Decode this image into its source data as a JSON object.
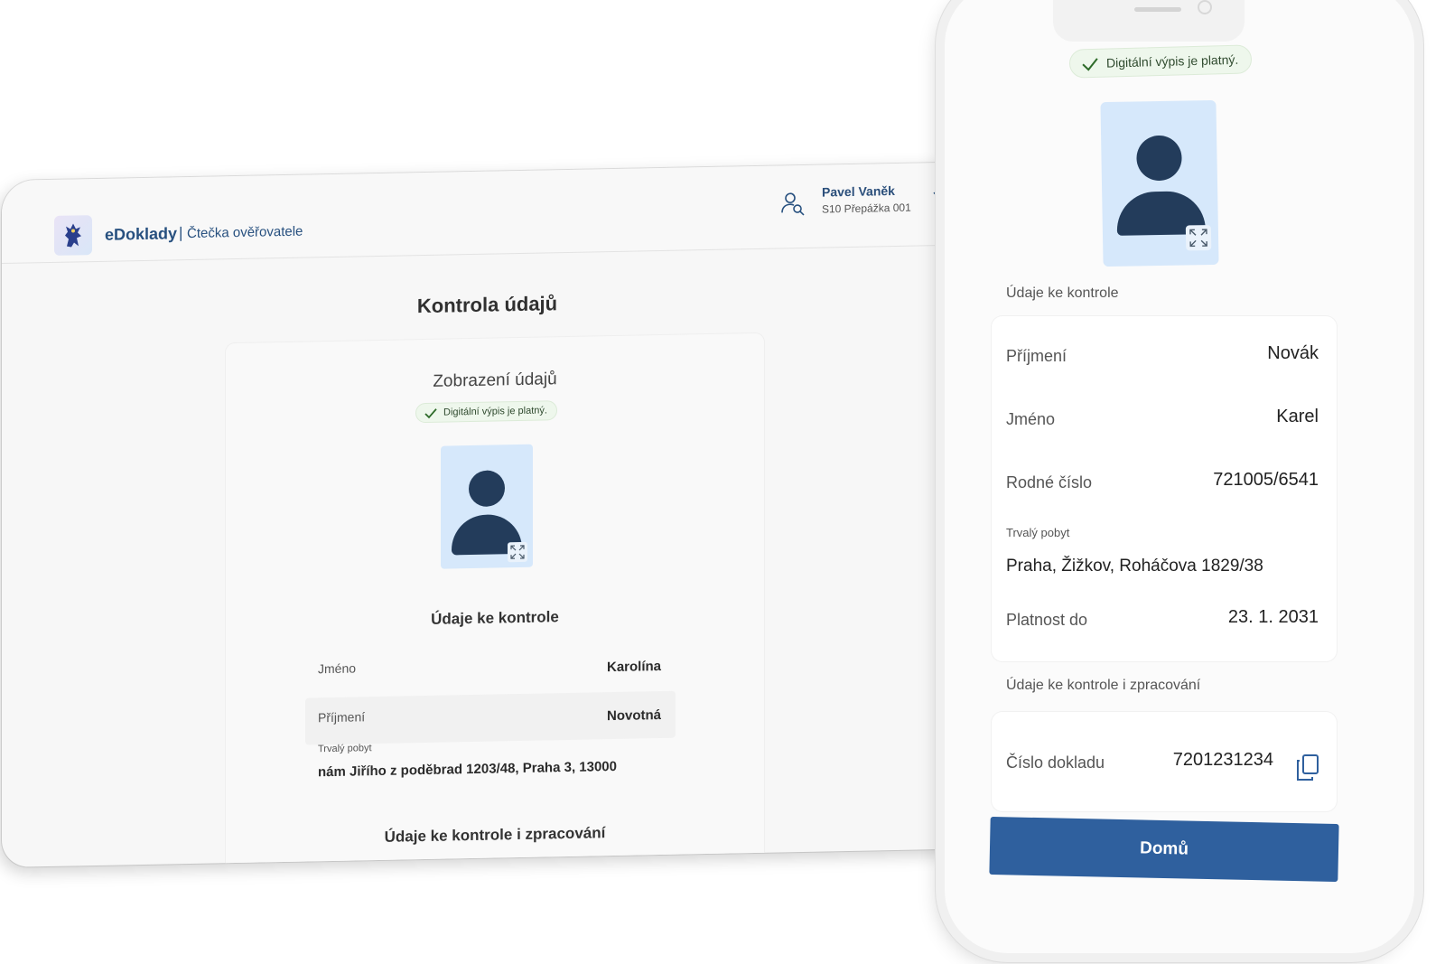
{
  "tablet": {
    "brand": "eDoklady",
    "separator": "|",
    "subtitle": "Čtečka ověřovatele",
    "user": {
      "name": "Pavel Vaněk",
      "desk": "S10 Přepážka 001"
    },
    "page_title": "Kontrola údajů",
    "card": {
      "title": "Zobrazení údajů",
      "badge": "Digitální výpis je platný.",
      "section_title": "Údaje ke kontrole",
      "rows": [
        {
          "label": "Jméno",
          "value": "Karolína"
        },
        {
          "label": "Příjmení",
          "value": "Novotná"
        }
      ],
      "address_label": "Trvalý pobyt",
      "address_value": "nám Jiřího z poděbrad 1203/48, Praha 3, 13000",
      "section2_title": "Údaje ke kontrole i zpracování"
    }
  },
  "phone": {
    "badge": "Digitální výpis je platný.",
    "section_title": "Údaje ke kontrole",
    "rows": [
      {
        "label": "Příjmení",
        "value": "Novák"
      },
      {
        "label": "Jméno",
        "value": "Karel"
      },
      {
        "label": "Rodné číslo",
        "value": "721005/6541"
      }
    ],
    "address_label": "Trvalý pobyt",
    "address_value": "Praha, Žižkov, Roháčova 1829/38",
    "validity_label": "Platnost do",
    "validity_value": "23. 1. 2031",
    "section2_title": "Údaje ke kontrole i zpracování",
    "doc_label": "Číslo dokladu",
    "doc_value": "7201231234",
    "home_button": "Domů"
  },
  "colors": {
    "brand_blue": "#27507f",
    "button_blue": "#2f609e",
    "photo_bg": "#d6e8fb",
    "silhouette": "#233c5b",
    "badge_bg": "#eef7ec",
    "check_green": "#2e6b2a"
  },
  "icons": [
    "lion-emblem-icon",
    "user-search-icon",
    "chevron-down-icon",
    "check-icon",
    "expand-icon",
    "copy-icon"
  ]
}
